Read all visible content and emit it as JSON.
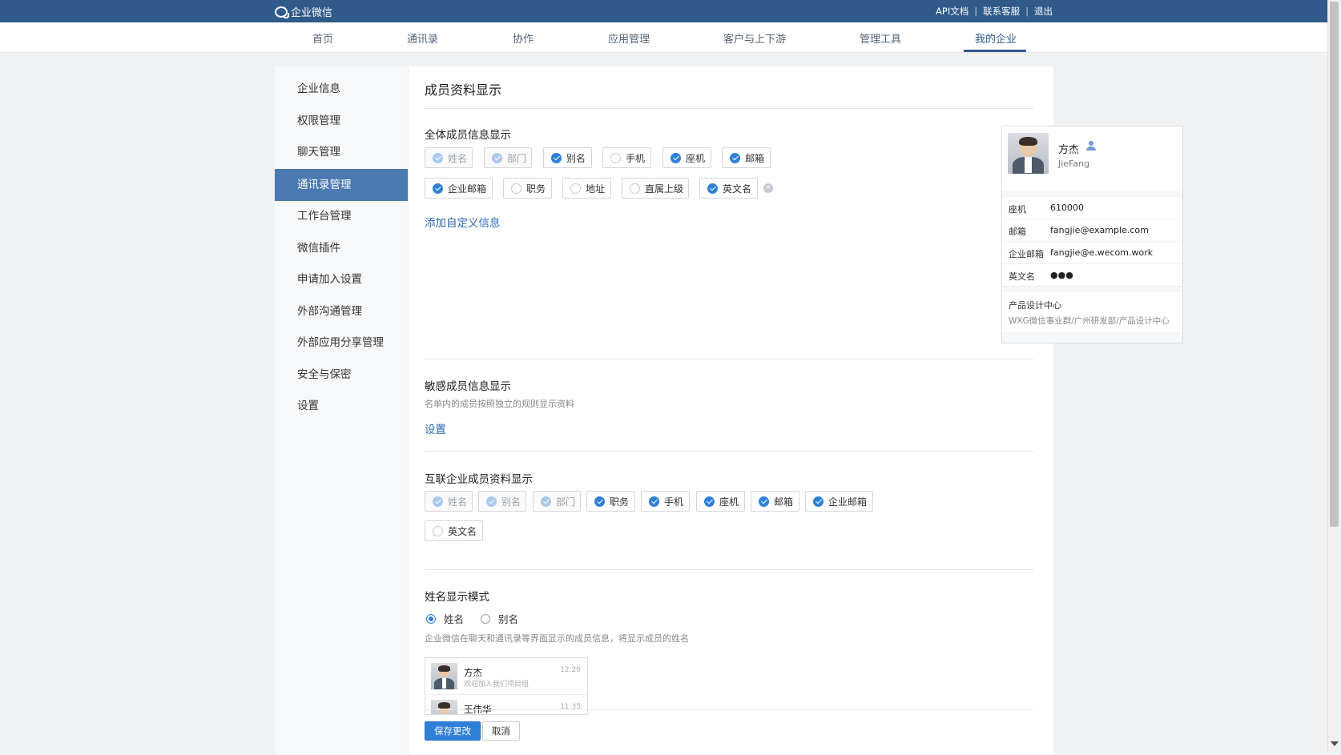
{
  "topbar": {
    "logo_text": "企业微信",
    "links": [
      "API文档",
      "联系客服",
      "退出"
    ]
  },
  "nav": {
    "items": [
      "首页",
      "通讯录",
      "协作",
      "应用管理",
      "客户与上下游",
      "管理工具",
      "我的企业"
    ],
    "active": "我的企业"
  },
  "sidebar": {
    "items": [
      "企业信息",
      "权限管理",
      "聊天管理",
      "通讯录管理",
      "工作台管理",
      "微信插件",
      "申请加入设置",
      "外部沟通管理",
      "外部应用分享管理",
      "安全与保密",
      "设置"
    ],
    "active": "通讯录管理"
  },
  "page": {
    "title": "成员资料显示"
  },
  "all_members": {
    "title": "全体成员信息显示",
    "fields": [
      {
        "label": "姓名",
        "checked": true,
        "disabled": true
      },
      {
        "label": "部门",
        "checked": true,
        "disabled": true
      },
      {
        "label": "别名",
        "checked": true,
        "disabled": false
      },
      {
        "label": "手机",
        "checked": false,
        "disabled": false
      },
      {
        "label": "座机",
        "checked": true,
        "disabled": false
      },
      {
        "label": "邮箱",
        "checked": true,
        "disabled": false
      },
      {
        "label": "企业邮箱",
        "checked": true,
        "disabled": false
      },
      {
        "label": "职务",
        "checked": false,
        "disabled": false
      },
      {
        "label": "地址",
        "checked": false,
        "disabled": false
      },
      {
        "label": "直属上级",
        "checked": false,
        "disabled": false
      },
      {
        "label": "英文名",
        "checked": true,
        "disabled": false
      }
    ],
    "add_custom_link": "添加自定义信息"
  },
  "preview_card": {
    "name": "方杰",
    "english": "JieFang",
    "rows": [
      {
        "key": "座机",
        "value": "610000"
      },
      {
        "key": "邮箱",
        "value": "fangjie@example.com"
      },
      {
        "key": "企业邮箱",
        "value": "fangjie@e.wecom.work"
      },
      {
        "key": "英文名",
        "value": "●●●"
      }
    ],
    "department": "产品设计中心",
    "department_path": "WXG微信事业群/广州研发部/产品设计中心"
  },
  "sensitive": {
    "title": "敏感成员信息显示",
    "desc": "名单内的成员按照独立的规则显示资料",
    "link": "设置"
  },
  "interconnect": {
    "title": "互联企业成员资料显示",
    "fields": [
      {
        "label": "姓名",
        "checked": true,
        "disabled": true
      },
      {
        "label": "别名",
        "checked": true,
        "disabled": true
      },
      {
        "label": "部门",
        "checked": true,
        "disabled": true
      },
      {
        "label": "职务",
        "checked": true,
        "disabled": false
      },
      {
        "label": "手机",
        "checked": true,
        "disabled": false
      },
      {
        "label": "座机",
        "checked": true,
        "disabled": false
      },
      {
        "label": "邮箱",
        "checked": true,
        "disabled": false
      },
      {
        "label": "企业邮箱",
        "checked": true,
        "disabled": false
      },
      {
        "label": "英文名",
        "checked": false,
        "disabled": false
      }
    ]
  },
  "name_mode": {
    "title": "姓名显示模式",
    "options": [
      {
        "label": "姓名",
        "selected": true
      },
      {
        "label": "别名",
        "selected": false
      }
    ],
    "desc": "企业微信在聊天和通讯录等界面显示的成员信息，将显示成员的姓名",
    "chat_preview": [
      {
        "name": "方杰",
        "message": "欢迎加入我们项目组",
        "time": "12:20"
      },
      {
        "name": "王伟华",
        "message": "",
        "time": "11:35"
      }
    ]
  },
  "actions": {
    "save": "保存更改",
    "cancel": "取消"
  },
  "colors": {
    "brand": "#2f5a8a",
    "accent": "#2f80d8",
    "sidebar_active": "#4b79b1"
  }
}
